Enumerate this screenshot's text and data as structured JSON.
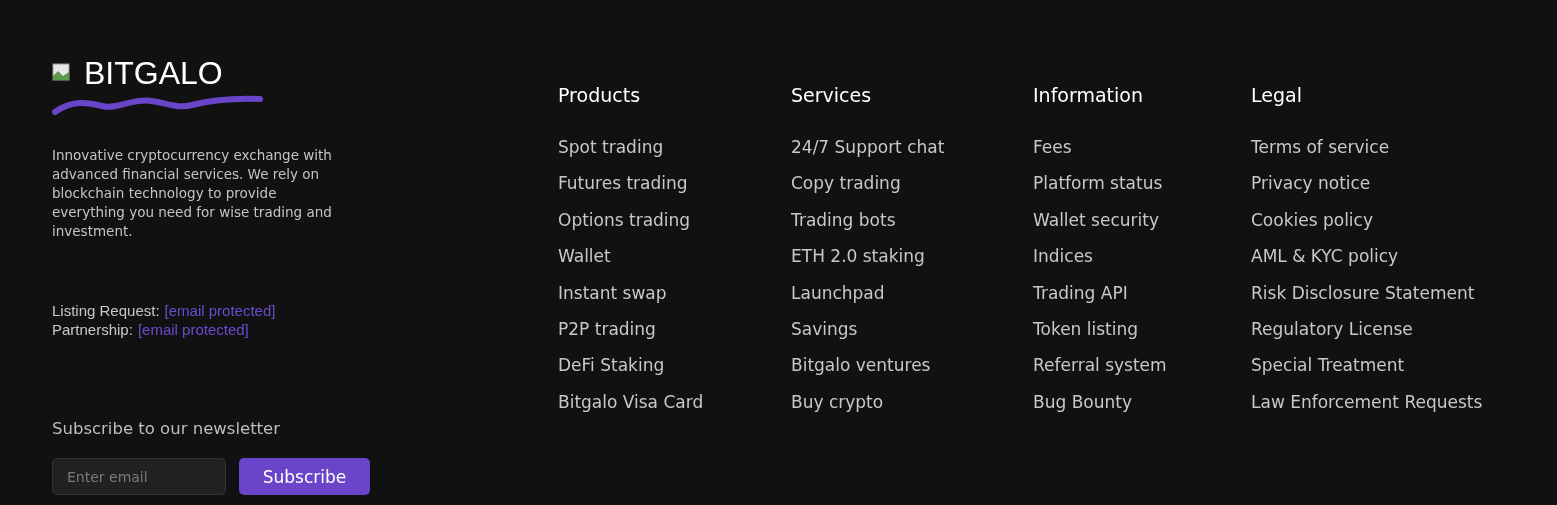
{
  "brand": {
    "name": "BITGALO"
  },
  "description": "Innovative cryptocurrency exchange with advanced financial services. We rely on blockchain technology to provide everything you need for wise trading and investment.",
  "contacts": [
    {
      "label": "Listing Request:",
      "link": "[email protected]"
    },
    {
      "label": "Partnership:",
      "link": "[email protected]"
    }
  ],
  "newsletter": {
    "title": "Subscribe to our newsletter",
    "placeholder": "Enter email",
    "button": "Subscribe"
  },
  "columns": [
    {
      "heading": "Products",
      "links": [
        "Spot trading",
        "Futures trading",
        "Options trading",
        "Wallet",
        "Instant swap",
        "P2P trading",
        "DeFi Staking",
        "Bitgalo Visa Card"
      ]
    },
    {
      "heading": "Services",
      "links": [
        "24/7 Support chat",
        "Copy trading",
        "Trading bots",
        "ETH 2.0 staking",
        "Launchpad",
        "Savings",
        "Bitgalo ventures",
        "Buy crypto"
      ]
    },
    {
      "heading": "Information",
      "links": [
        "Fees",
        "Platform status",
        "Wallet security",
        "Indices",
        "Trading API",
        "Token listing",
        "Referral system",
        "Bug Bounty"
      ]
    },
    {
      "heading": "Legal",
      "links": [
        "Terms of service",
        "Privacy notice",
        "Cookies policy",
        "AML & KYC policy",
        "Risk Disclosure Statement",
        "Regulatory License",
        "Special Treatment",
        "Law Enforcement Requests"
      ]
    }
  ]
}
